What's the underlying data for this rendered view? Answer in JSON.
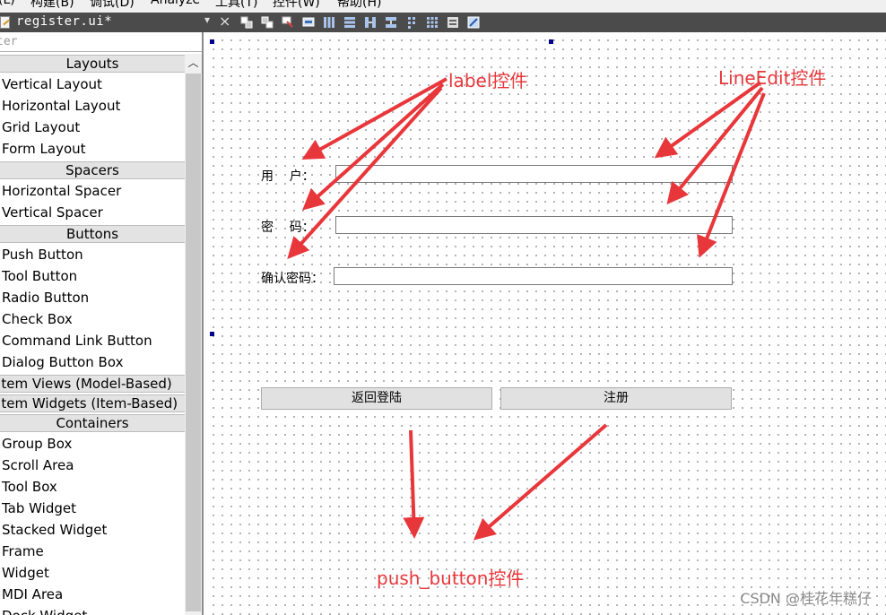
{
  "menubar": {
    "items": [
      "(L)",
      "构建(B)",
      "调试(D)",
      "Analyze",
      "工具(T)",
      "控件(W)",
      "帮助(H)"
    ]
  },
  "toolbar": {
    "file_name": "register.ui*",
    "dropdown_glyph": "▾",
    "close_glyph": "×"
  },
  "widget_box": {
    "filter_placeholder": "ter",
    "categories": {
      "layouts": "Layouts",
      "spacers": "Spacers",
      "buttons": "Buttons",
      "item_views": "Item Views (Model-Based)",
      "item_widgets": "Item Widgets (Item-Based)",
      "containers": "Containers"
    },
    "layouts": [
      "Vertical Layout",
      "Horizontal Layout",
      "Grid Layout",
      "Form Layout"
    ],
    "spacers": [
      "Horizontal Spacer",
      "Vertical Spacer"
    ],
    "buttons": [
      "Push Button",
      "Tool Button",
      "Radio Button",
      "Check Box",
      "Command Link Button",
      "Dialog Button Box"
    ],
    "containers": [
      "Group Box",
      "Scroll Area",
      "Tool Box",
      "Tab Widget",
      "Stacked Widget",
      "Frame",
      "Widget",
      "MDI Area",
      "Dock Widget"
    ]
  },
  "form": {
    "label_user": "用    户：",
    "label_password": "密    码：",
    "label_confirm": "确认密码：",
    "input_user": "",
    "input_password": "",
    "input_confirm": "",
    "button_back": "返回登陆",
    "button_register": "注册"
  },
  "annotations": {
    "label": "label控件",
    "lineedit": "LineEdit控件",
    "push_button": "push_button控件",
    "color": "#e8373b"
  },
  "watermark": "CSDN @桂花年糕仔"
}
